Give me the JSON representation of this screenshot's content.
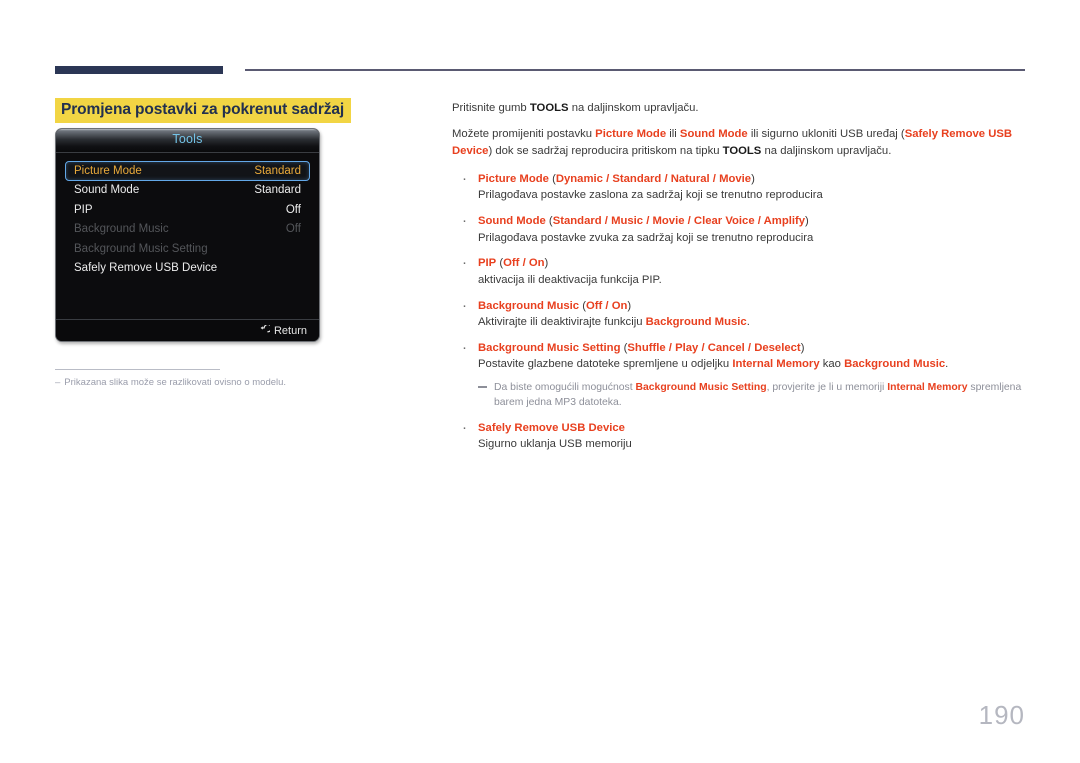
{
  "page": {
    "number": "190"
  },
  "section": {
    "title": "Promjena postavki za pokrenut sadržaj"
  },
  "tv_menu": {
    "title": "Tools",
    "rows": [
      {
        "label": "Picture Mode",
        "value": "Standard",
        "state": "selected"
      },
      {
        "label": "Sound Mode",
        "value": "Standard",
        "state": "normal"
      },
      {
        "label": "PIP",
        "value": "Off",
        "state": "normal"
      },
      {
        "label": "Background Music",
        "value": "Off",
        "state": "disabled"
      },
      {
        "label": "Background Music Setting",
        "value": "",
        "state": "disabled"
      },
      {
        "label": "Safely Remove USB Device",
        "value": "",
        "state": "normal"
      }
    ],
    "footer_button": "Return",
    "footer_icon": "return-arrow-icon",
    "colors": {
      "selected_text": "#e8a93a",
      "selection_border": "#63a8e8",
      "title_text": "#74c4e8",
      "disabled_text": "#54565a"
    }
  },
  "image_footnote": {
    "dash": "–",
    "text": "Prikazana slika može se razlikovati ovisno o modelu."
  },
  "content": {
    "intro_1": {
      "before": "Pritisnite gumb ",
      "key": "TOOLS",
      "after": " na daljinskom upravljaču."
    },
    "intro_2": {
      "p1": "Možete promijeniti postavku ",
      "k1": "Picture Mode",
      "p2": " ili ",
      "k2": "Sound Mode",
      "p3": " ili sigurno ukloniti USB uređaj (",
      "k3": "Safely Remove USB Device",
      "p4": ") dok se sadržaj reproducira pritiskom na tipku ",
      "k4": "TOOLS",
      "p5": " na daljinskom upravljaču."
    },
    "bullets": [
      {
        "name": "Picture Mode",
        "options_open": " (",
        "options": "Dynamic / Standard / Natural / Movie",
        "options_close": ")",
        "desc": "Prilagođava postavke zaslona za sadržaj koji se trenutno reproducira"
      },
      {
        "name": "Sound Mode",
        "options_open": " (",
        "options": "Standard / Music / Movie / Clear Voice / Amplify",
        "options_close": ")",
        "desc": "Prilagođava postavke zvuka za sadržaj koji se trenutno reproducira"
      },
      {
        "name": "PIP",
        "options_open": " (",
        "options": "Off / On",
        "options_close": ")",
        "desc": "aktivacija ili deaktivacija funkcija PIP."
      },
      {
        "name": "Background Music",
        "options_open": " (",
        "options": "Off / On",
        "options_close": ")",
        "desc_pre": "Aktivirajte ili deaktivirajte funkciju ",
        "desc_key": "Background Music",
        "desc_post": "."
      },
      {
        "name": "Background Music Setting",
        "options_open": " (",
        "options": "Shuffle / Play / Cancel / Deselect",
        "options_close": ")",
        "desc_pre": "Postavite glazbene datoteke spremljene u odjeljku ",
        "desc_key": "Internal Memory",
        "desc_mid": " kao ",
        "desc_key2": "Background Music",
        "desc_post": "."
      },
      {
        "name": "Safely Remove USB Device",
        "desc": "Sigurno uklanja USB memoriju"
      }
    ],
    "subnote": {
      "p1": "Da biste omogućili mogućnost ",
      "k1": "Background Music Setting",
      "p2": ", provjerite je li u memoriji ",
      "k2": "Internal Memory",
      "p3": " spremljena barem jedna MP3 datoteka."
    }
  }
}
